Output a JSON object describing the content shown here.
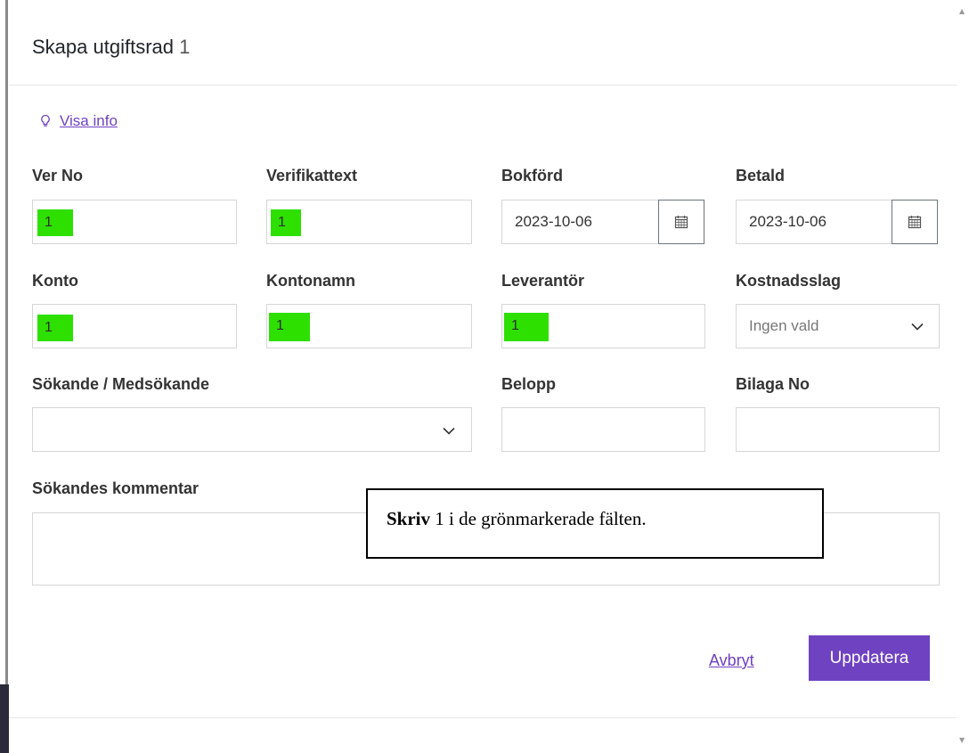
{
  "modal": {
    "title": "Skapa utgiftsrad",
    "title_number": "1"
  },
  "info_link": {
    "label": "Visa info",
    "icon": "lightbulb-icon"
  },
  "fields": {
    "ver_no": {
      "label": "Ver No",
      "value": "1"
    },
    "verifikattext": {
      "label": "Verifikattext",
      "value": "1"
    },
    "bokford": {
      "label": "Bokförd",
      "value": "2023-10-06",
      "icon": "calendar-icon"
    },
    "betald": {
      "label": "Betald",
      "value": "2023-10-06",
      "icon": "calendar-icon"
    },
    "konto": {
      "label": "Konto",
      "value": "1"
    },
    "kontonamn": {
      "label": "Kontonamn",
      "value": "1"
    },
    "leverantor": {
      "label": "Leverantör",
      "value": "1"
    },
    "kostnadsslag": {
      "label": "Kostnadsslag",
      "placeholder": "Ingen vald",
      "icon": "chevron-down-icon"
    },
    "sokande": {
      "label": "Sökande / Medsökande",
      "value": "",
      "icon": "chevron-down-icon"
    },
    "belopp": {
      "label": "Belopp",
      "value": ""
    },
    "bilaga_no": {
      "label": "Bilaga No",
      "value": ""
    },
    "kommentar": {
      "label": "Sökandes kommentar",
      "value": ""
    }
  },
  "actions": {
    "cancel": "Avbryt",
    "update": "Uppdatera"
  },
  "callout": {
    "bold": "Skriv",
    "rest": " 1 i de grönmarkerade fälten."
  },
  "colors": {
    "accent": "#6f42c1",
    "highlight": "#2ee000"
  }
}
